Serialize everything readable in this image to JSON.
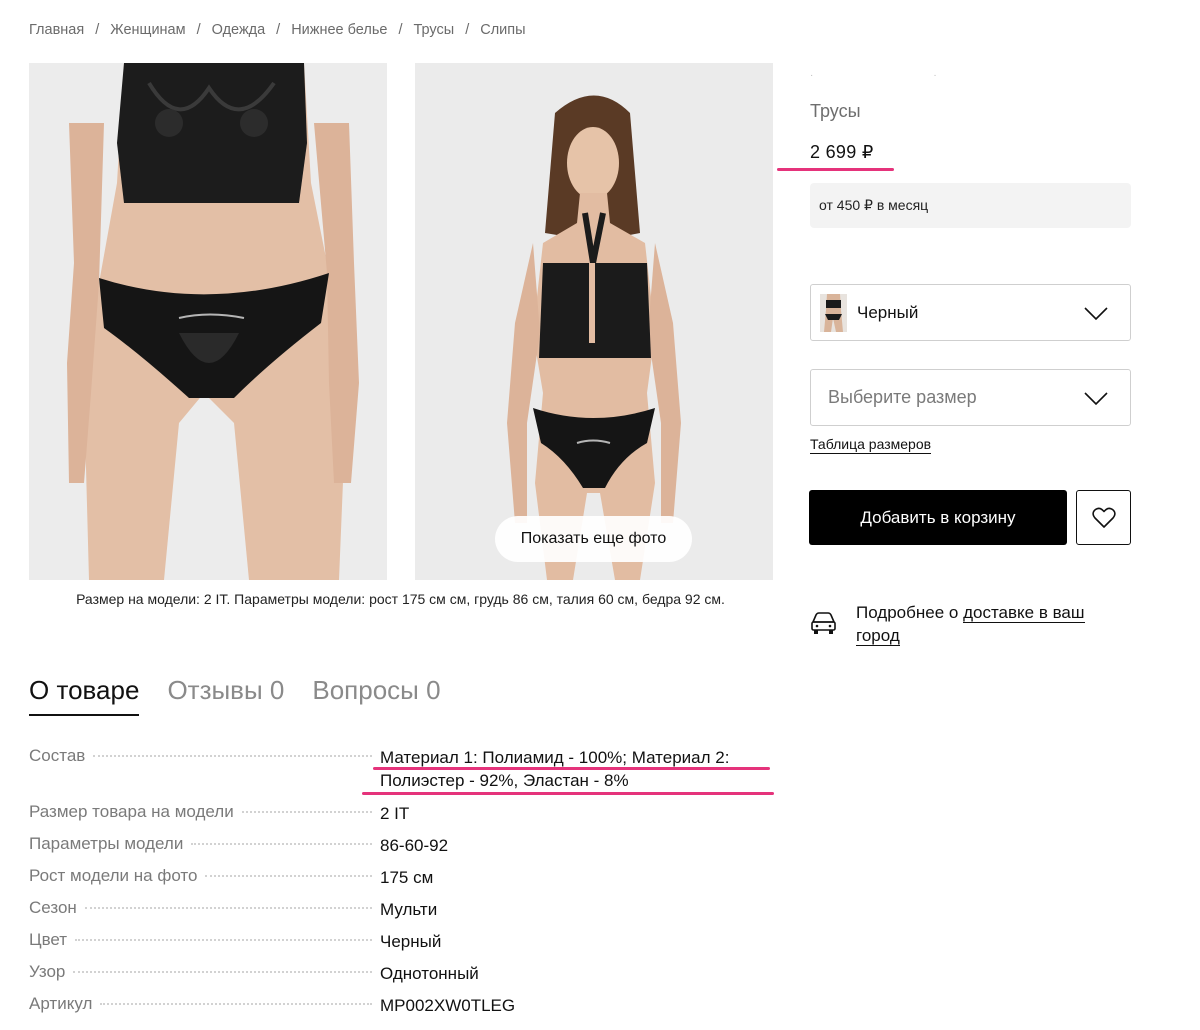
{
  "breadcrumb": [
    "Главная",
    "Женщинам",
    "Одежда",
    "Нижнее белье",
    "Трусы",
    "Слипы"
  ],
  "breadcrumb_separator": "/",
  "product": {
    "type": "Трусы",
    "price": "2 699 ₽",
    "installment": "от 450 ₽ в месяц"
  },
  "gallery": {
    "more_photos_label": "Показать еще фото",
    "model_caption": "Размер на модели: 2 IT. Параметры модели: рост 175 см см, грудь 86 см, талия 60 см, бедра 92 см."
  },
  "selectors": {
    "color_value": "Черный",
    "size_placeholder": "Выберите размер",
    "size_table_link": "Таблица размеров"
  },
  "actions": {
    "add_to_cart": "Добавить в корзину"
  },
  "delivery": {
    "prefix": "Подробнее о ",
    "link": "доставке в ваш город"
  },
  "tabs": [
    {
      "label": "О товаре"
    },
    {
      "label": "Отзывы 0"
    },
    {
      "label": "Вопросы 0"
    }
  ],
  "specs": [
    {
      "label": "Состав",
      "value": "Материал 1: Полиамид - 100%; Материал 2: Полиэстер - 92%, Эластан - 8%"
    },
    {
      "label": "Размер товара на модели",
      "value": "2 IT"
    },
    {
      "label": "Параметры модели",
      "value": "86-60-92"
    },
    {
      "label": "Рост модели на фото",
      "value": "175 см"
    },
    {
      "label": "Сезон",
      "value": "Мульти"
    },
    {
      "label": "Цвет",
      "value": "Черный"
    },
    {
      "label": "Узор",
      "value": "Однотонный"
    },
    {
      "label": "Артикул",
      "value": "MP002XW0TLEG"
    }
  ],
  "colors": {
    "highlight": "#e5337b",
    "primary_button": "#000000",
    "muted_text": "#7a7a7a"
  },
  "icons": [
    "chevron-down-icon",
    "heart-icon",
    "car-icon"
  ]
}
